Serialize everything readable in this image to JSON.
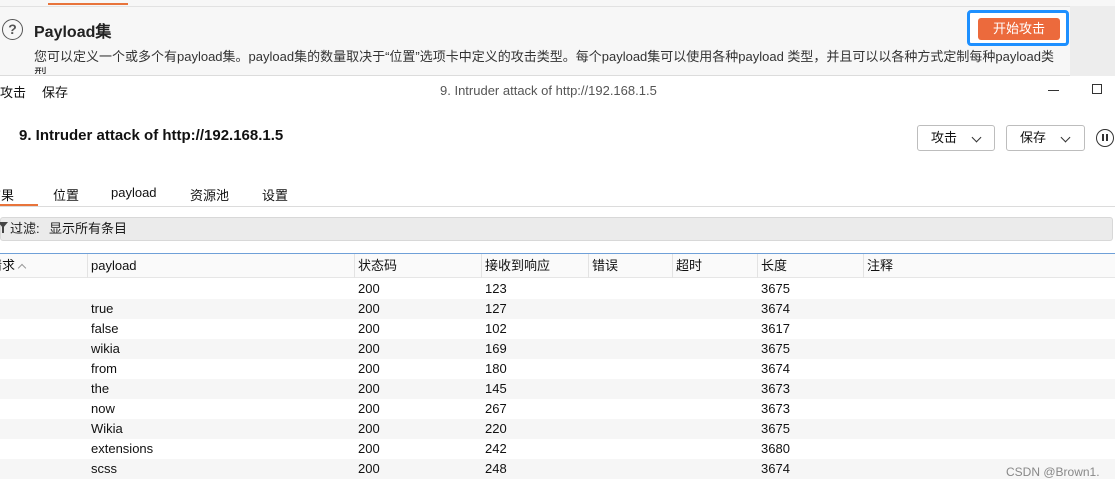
{
  "background_panel": {
    "title": "Payload集",
    "description": "您可以定义一个或多个有payload集。payload集的数量取决于“位置”选项卡中定义的攻击类型。每个payload集可以使用各种payload 类型，并且可以以各种方式定制每种payload类型。",
    "start_attack_label": "开始攻击"
  },
  "window": {
    "menu": [
      "攻击",
      "保存"
    ],
    "title": "9. Intruder attack of http://192.168.1.5"
  },
  "header": {
    "title": "9. Intruder attack of http://192.168.1.5",
    "attack_button": "攻击",
    "save_button": "保存"
  },
  "tabs": [
    "结果",
    "位置",
    "payload",
    "资源池",
    "设置"
  ],
  "active_tab": "结果",
  "filter": {
    "label": "过滤:",
    "value": "显示所有条目"
  },
  "table": {
    "columns": [
      "请求",
      "payload",
      "状态码",
      "接收到响应",
      "错误",
      "超时",
      "长度",
      "注释"
    ],
    "rows": [
      {
        "payload": "",
        "status": "200",
        "received": "123",
        "length": "3675"
      },
      {
        "payload": "true",
        "status": "200",
        "received": "127",
        "length": "3674"
      },
      {
        "payload": "false",
        "status": "200",
        "received": "102",
        "length": "3617"
      },
      {
        "payload": "wikia",
        "status": "200",
        "received": "169",
        "length": "3675"
      },
      {
        "payload": "from",
        "status": "200",
        "received": "180",
        "length": "3674"
      },
      {
        "payload": "the",
        "status": "200",
        "received": "145",
        "length": "3673"
      },
      {
        "payload": "now",
        "status": "200",
        "received": "267",
        "length": "3673"
      },
      {
        "payload": "Wikia",
        "status": "200",
        "received": "220",
        "length": "3675"
      },
      {
        "payload": "extensions",
        "status": "200",
        "received": "242",
        "length": "3680"
      },
      {
        "payload": "scss",
        "status": "200",
        "received": "248",
        "length": "3674"
      }
    ]
  },
  "watermark": "CSDN @Brown1."
}
